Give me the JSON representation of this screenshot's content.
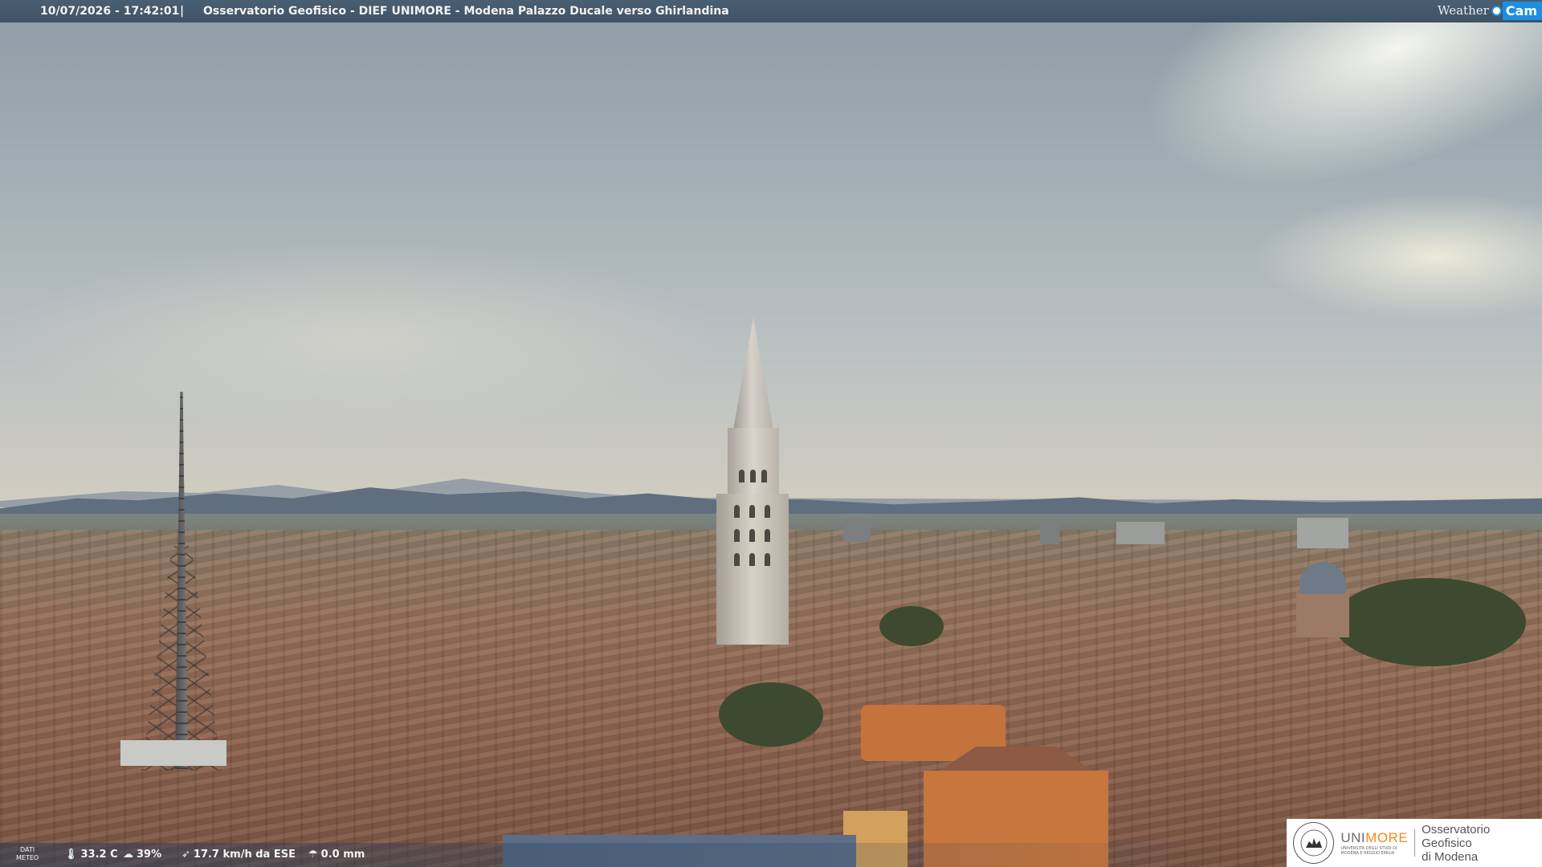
{
  "header": {
    "timestamp": "10/07/2026 - 17:42:01",
    "separator": "|",
    "caption": "Osservatorio Geofisico - DIEF UNIMORE - Modena Palazzo Ducale verso Ghirlandina"
  },
  "brand": {
    "weather": "Weather",
    "cam": "Cam",
    "accent": "#1d8ee0"
  },
  "meteo": {
    "label_line1": "DATI",
    "label_line2": "METEO",
    "temperature": "33.2 C",
    "humidity": "39%",
    "wind": "17.7 km/h da ESE",
    "rain": "0.0 mm",
    "icons": {
      "temperature": "thermometer-icon",
      "humidity": "humidity-drop-icon",
      "wind": "wind-icon",
      "rain": "rain-icon"
    }
  },
  "logo": {
    "uni_prefix": "UNI",
    "uni_suffix": "MORE",
    "uni_sub_line1": "UNIVERSITÀ DEGLI STUDI DI",
    "uni_sub_line2": "MODENA E REGGIO EMILIA",
    "obs_line1": "Osservatorio Geofisico",
    "obs_line2": "di Modena",
    "accent": "#f08a1c"
  }
}
